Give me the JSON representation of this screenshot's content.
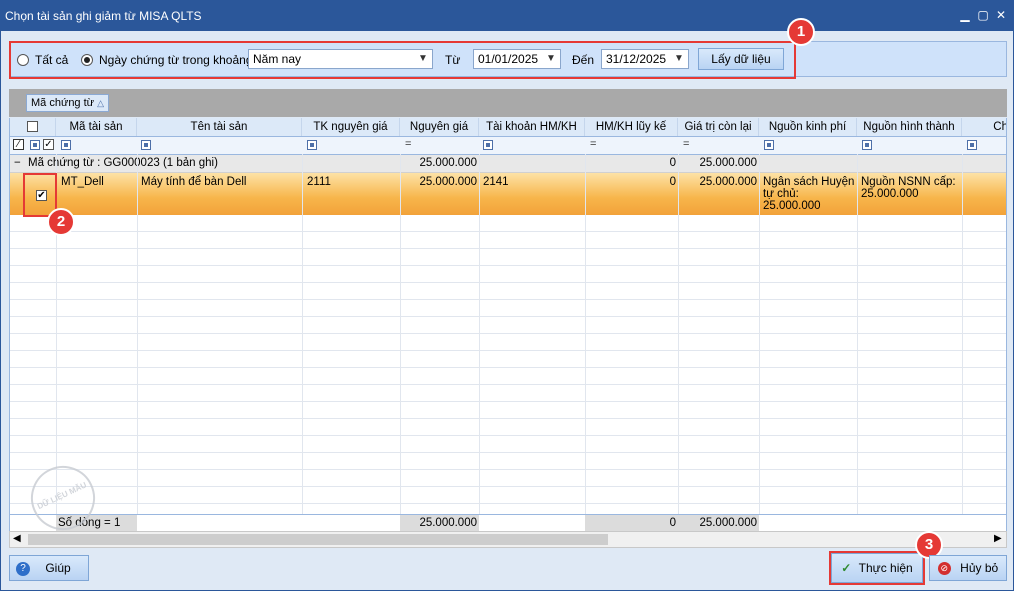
{
  "window": {
    "title": "Chọn tài sản ghi giảm từ MISA QLTS"
  },
  "filter": {
    "radio_all_label": "Tất cả",
    "radio_range_label": "Ngày chứng từ trong khoảng",
    "period_value": "Năm nay",
    "from_label": "Từ",
    "from_value": "01/01/2025",
    "to_label": "Đến",
    "to_value": "31/12/2025",
    "fetch_label": "Lấy dữ liệu"
  },
  "grouping": {
    "chip_label": "Mã chứng từ"
  },
  "grid": {
    "columns": [
      "Mã tài sản",
      "Tên tài sản",
      "TK nguyên giá",
      "Nguyên giá",
      "Tài khoản HM/KH",
      "HM/KH lũy kế",
      "Giá trị còn lại",
      "Nguồn kinh phí",
      "Nguồn hình thành",
      "Ch"
    ],
    "group_row": {
      "label": "Mã chứng từ : GG000023 (1 bản ghi)",
      "nguyen_gia": "25.000.000",
      "hm_kh": "0",
      "gia_tri_con_lai": "25.000.000"
    },
    "rows": [
      {
        "checked": true,
        "ma_tai_san": "MT_Dell",
        "ten_tai_san": "Máy tính để bàn Dell",
        "tk_nguyen_gia": "2111",
        "nguyen_gia": "25.000.000",
        "tai_khoan_hm": "2141",
        "hm_luy_ke": "0",
        "gia_tri_con_lai": "25.000.000",
        "nguon_kinh_phi_1": "Ngân sách Huyện",
        "nguon_kinh_phi_2": "tự chủ:",
        "nguon_kinh_phi_3": "25.000.000",
        "nguon_hinh_thanh_1": "Nguồn NSNN cấp:",
        "nguon_hinh_thanh_2": "25.000.000"
      }
    ],
    "footer": {
      "count": "Số dòng = 1",
      "nguyen_gia": "25.000.000",
      "hm_kh": "0",
      "gia_tri_con_lai": "25.000.000"
    }
  },
  "watermark": "DỮ LIỆU MẪU",
  "buttons": {
    "help": "Giúp",
    "execute": "Thực hiện",
    "cancel": "Hủy bỏ"
  },
  "badges": [
    "1",
    "2",
    "3"
  ],
  "colors": {
    "accent": "#2b579a",
    "highlight": "#e53935",
    "selection": "#f7b54a"
  }
}
